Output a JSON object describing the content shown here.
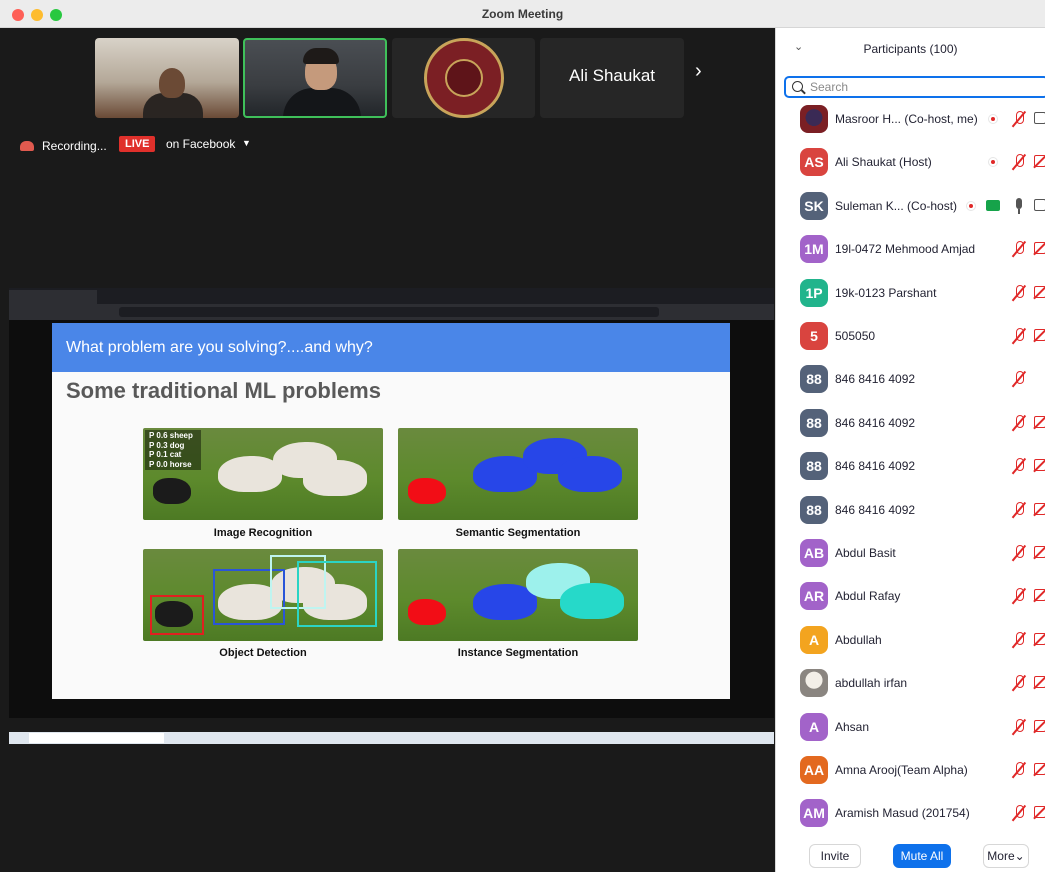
{
  "window": {
    "title": "Zoom Meeting"
  },
  "video_strip": {
    "tiles": [
      {
        "kind": "video"
      },
      {
        "kind": "video",
        "active_speaker": true
      },
      {
        "kind": "logo"
      },
      {
        "kind": "name",
        "name": "Ali Shaukat"
      }
    ],
    "next_icon": "chevron-right-icon"
  },
  "status": {
    "recording_label": "Recording...",
    "live_badge": "LIVE",
    "live_target": "on Facebook"
  },
  "slide": {
    "header": "What problem are you solving?....and why?",
    "title": "Some traditional ML problems",
    "panels": [
      {
        "caption": "Image Recognition",
        "labels": [
          "P 0.6 sheep",
          "P 0.3 dog",
          "P 0.1 cat",
          "P 0.0 horse"
        ]
      },
      {
        "caption": "Semantic Segmentation"
      },
      {
        "caption": "Object Detection"
      },
      {
        "caption": "Instance Segmentation"
      }
    ]
  },
  "participants": {
    "title": "Participants (100)",
    "search_placeholder": "Search",
    "list": [
      {
        "initials": "",
        "avatar": "image",
        "name": "Masroor H...  (Co-host, me)",
        "recording": true,
        "mic": "muted",
        "cam": "on"
      },
      {
        "initials": "AS",
        "color": "#d9443f",
        "name": "Ali Shaukat (Host)",
        "recording": true,
        "mic": "muted",
        "cam": "off"
      },
      {
        "initials": "SK",
        "color": "#546279",
        "name": "Suleman K...  (Co-host)",
        "recording": true,
        "share": true,
        "mic": "on",
        "cam": "on"
      },
      {
        "initials": "1M",
        "color": "#a263c9",
        "name": "19l-0472 Mehmood Amjad",
        "mic": "muted",
        "cam": "off"
      },
      {
        "initials": "1P",
        "color": "#21b48c",
        "name": "19k-0123 Parshant",
        "mic": "muted",
        "cam": "off"
      },
      {
        "initials": "5",
        "color": "#d9443f",
        "name": "505050",
        "mic": "muted",
        "cam": "off"
      },
      {
        "initials": "88",
        "color": "#546279",
        "name": "846 8416 4092",
        "mic": "muted",
        "cam": "none"
      },
      {
        "initials": "88",
        "color": "#546279",
        "name": "846 8416 4092",
        "mic": "muted",
        "cam": "off"
      },
      {
        "initials": "88",
        "color": "#546279",
        "name": "846 8416 4092",
        "mic": "muted",
        "cam": "off"
      },
      {
        "initials": "88",
        "color": "#546279",
        "name": "846 8416 4092",
        "mic": "muted",
        "cam": "off"
      },
      {
        "initials": "AB",
        "color": "#a263c9",
        "name": "Abdul Basit",
        "mic": "muted",
        "cam": "off"
      },
      {
        "initials": "AR",
        "color": "#a263c9",
        "name": "Abdul Rafay",
        "mic": "muted",
        "cam": "off"
      },
      {
        "initials": "A",
        "color": "#f3a41f",
        "name": "Abdullah",
        "mic": "muted",
        "cam": "off"
      },
      {
        "initials": "",
        "avatar": "photo",
        "name": "abdullah irfan",
        "mic": "muted",
        "cam": "off"
      },
      {
        "initials": "A",
        "color": "#a263c9",
        "name": "Ahsan",
        "mic": "muted",
        "cam": "off"
      },
      {
        "initials": "AA",
        "color": "#e3691f",
        "name": "Amna Arooj(Team Alpha)",
        "mic": "muted",
        "cam": "off"
      },
      {
        "initials": "AM",
        "color": "#a263c9",
        "name": "Aramish Masud (201754)",
        "mic": "muted",
        "cam": "off"
      }
    ]
  },
  "footer": {
    "invite_label": "Invite",
    "mute_all_label": "Mute All",
    "more_label": "More⌄"
  }
}
